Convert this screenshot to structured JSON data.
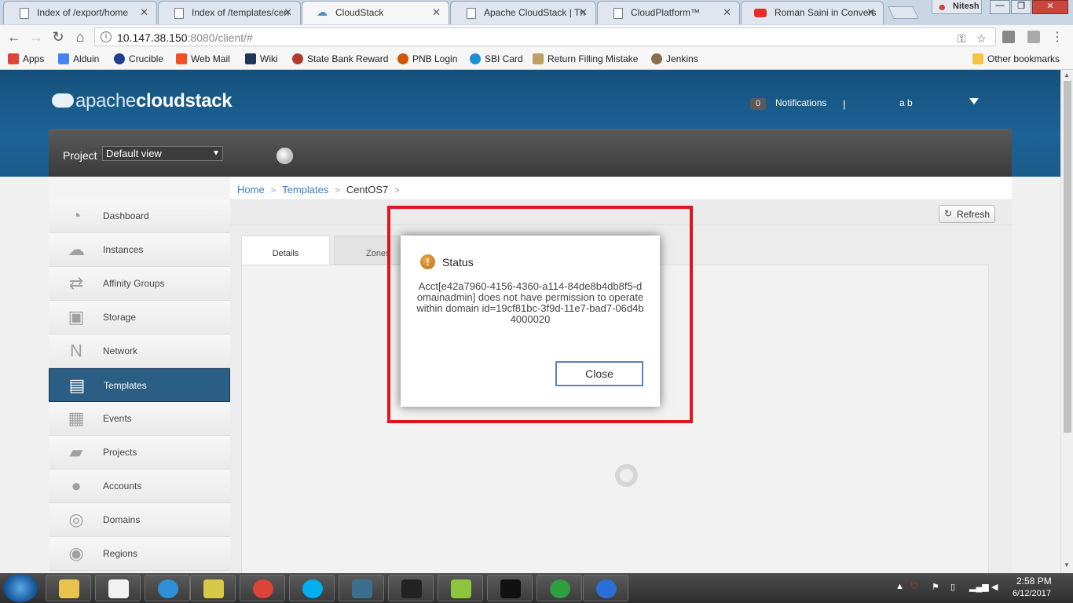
{
  "browser": {
    "tabs": [
      {
        "title": "Index of /export/home",
        "icon": "page-icon"
      },
      {
        "title": "Index of /templates/cen",
        "icon": "page-icon"
      },
      {
        "title": "CloudStack",
        "icon": "cloud-icon"
      },
      {
        "title": "Apache CloudStack | Th",
        "icon": "page-icon"
      },
      {
        "title": "CloudPlatform™",
        "icon": "page-icon"
      },
      {
        "title": "Roman Saini in Convers",
        "icon": "youtube-icon"
      }
    ],
    "profile_name": "Nitesh",
    "url_host": "10.147.38.150",
    "url_rest": ":8080/client/#",
    "bookmarks": [
      {
        "label": "Apps",
        "color": "#e0433a"
      },
      {
        "label": "Alduin",
        "color": "#4285f4"
      },
      {
        "label": "Crucible",
        "color": "#1f3f8f"
      },
      {
        "label": "Web Mail",
        "color": "#f25022"
      },
      {
        "label": "Wiki",
        "color": "#23365a"
      },
      {
        "label": "State Bank Reward",
        "color": "#b03a2e"
      },
      {
        "label": "PNB Login",
        "color": "#d35400"
      },
      {
        "label": "SBI Card",
        "color": "#1a8fd6"
      },
      {
        "label": "Return Filling Mistake",
        "color": "#c0a060"
      },
      {
        "label": "Jenkins",
        "color": "#8a6d4a"
      }
    ],
    "other_bookmarks": "Other bookmarks"
  },
  "header": {
    "logo_part1": "apache",
    "logo_part2": "cloudstack",
    "notifications_count": "0",
    "notifications_label": "Notifications",
    "separator": "|",
    "user": "a b"
  },
  "project": {
    "label": "Project",
    "selected": "Default view"
  },
  "sidebar": {
    "items": [
      {
        "label": "Dashboard",
        "icon": "dashboard-icon",
        "glyph": "◔"
      },
      {
        "label": "Instances",
        "icon": "cloud-icon",
        "glyph": "☁"
      },
      {
        "label": "Affinity Groups",
        "icon": "affinity-icon",
        "glyph": "⇄"
      },
      {
        "label": "Storage",
        "icon": "storage-icon",
        "glyph": "▣"
      },
      {
        "label": "Network",
        "icon": "network-icon",
        "glyph": "N"
      },
      {
        "label": "Templates",
        "icon": "templates-icon",
        "glyph": "▤"
      },
      {
        "label": "Events",
        "icon": "calendar-icon",
        "glyph": "▦"
      },
      {
        "label": "Projects",
        "icon": "folder-icon",
        "glyph": "▰"
      },
      {
        "label": "Accounts",
        "icon": "user-icon",
        "glyph": "●"
      },
      {
        "label": "Domains",
        "icon": "domains-icon",
        "glyph": "◎"
      },
      {
        "label": "Regions",
        "icon": "globe-icon",
        "glyph": "◉"
      }
    ],
    "active": "Templates"
  },
  "breadcrumb": {
    "home": "Home",
    "templates": "Templates",
    "current": "CentOS7",
    "sep": ">"
  },
  "toolbar": {
    "refresh_label": "Refresh"
  },
  "detail_tabs": {
    "details": "Details",
    "zones": "Zones"
  },
  "dialog": {
    "title": "Status",
    "message": "Acct[e42a7960-4156-4360-a114-84de8b4db8f5-domainadmin] does not have permission to operate within domain id=19cf81bc-3f9d-11e7-bad7-06d4b4000020",
    "close_label": "Close"
  },
  "taskbar": {
    "time": "2:58 PM",
    "date": "6/12/2017",
    "apps": [
      {
        "name": "explorer-icon",
        "color": "#e8c34e"
      },
      {
        "name": "7zip-icon",
        "color": "#f2f2f2"
      },
      {
        "name": "ie-icon",
        "color": "#2f8fd8"
      },
      {
        "name": "network-tool-icon",
        "color": "#d8c84a"
      },
      {
        "name": "chrome-icon",
        "color": "#db4437"
      },
      {
        "name": "skype-icon",
        "color": "#00aff0"
      },
      {
        "name": "mysql-workbench-icon",
        "color": "#3b6e8f"
      },
      {
        "name": "intellij-icon",
        "color": "#222222"
      },
      {
        "name": "editor-icon",
        "color": "#8cc63f"
      },
      {
        "name": "cmd-icon",
        "color": "#111111"
      },
      {
        "name": "vpn-icon",
        "color": "#2e9e3e"
      },
      {
        "name": "xmanager-icon",
        "color": "#2a6fd6"
      }
    ]
  }
}
